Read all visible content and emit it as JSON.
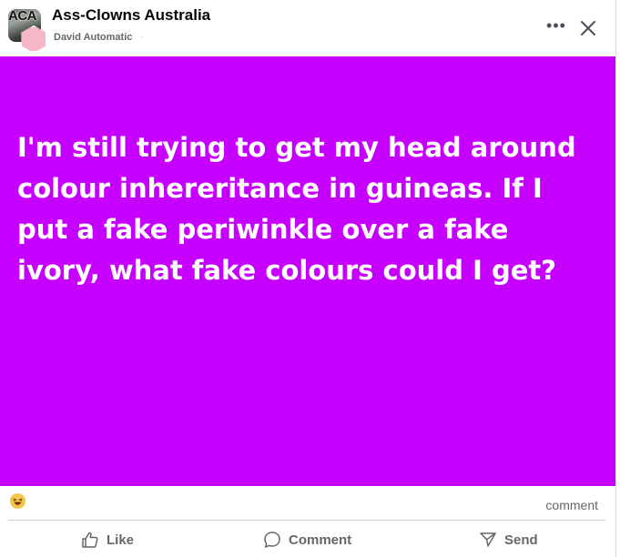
{
  "header": {
    "group_avatar_text": "ACA",
    "group_name": "Ass-Clowns Australia",
    "author": "David Automatic",
    "separator": "·",
    "more_label": "•••",
    "icons": {
      "group_avatar": "group-avatar",
      "user_avatar": "user-avatar",
      "more": "more-options-icon",
      "close": "close-icon"
    }
  },
  "post": {
    "text": "I'm still trying to get my head around colour inhereritance in guineas. If I put a fake periwinkle over a fake ivory, what fake colours could I get?",
    "background_color": "#c600ff",
    "text_color": "#ffffff"
  },
  "reactions": {
    "icon": "laughing-emoji-icon",
    "comment_count_label": "comment"
  },
  "actions": {
    "like_label": "Like",
    "comment_label": "Comment",
    "send_label": "Send",
    "icons": {
      "like": "thumbs-up-icon",
      "comment": "speech-bubble-icon",
      "send": "send-icon"
    }
  }
}
